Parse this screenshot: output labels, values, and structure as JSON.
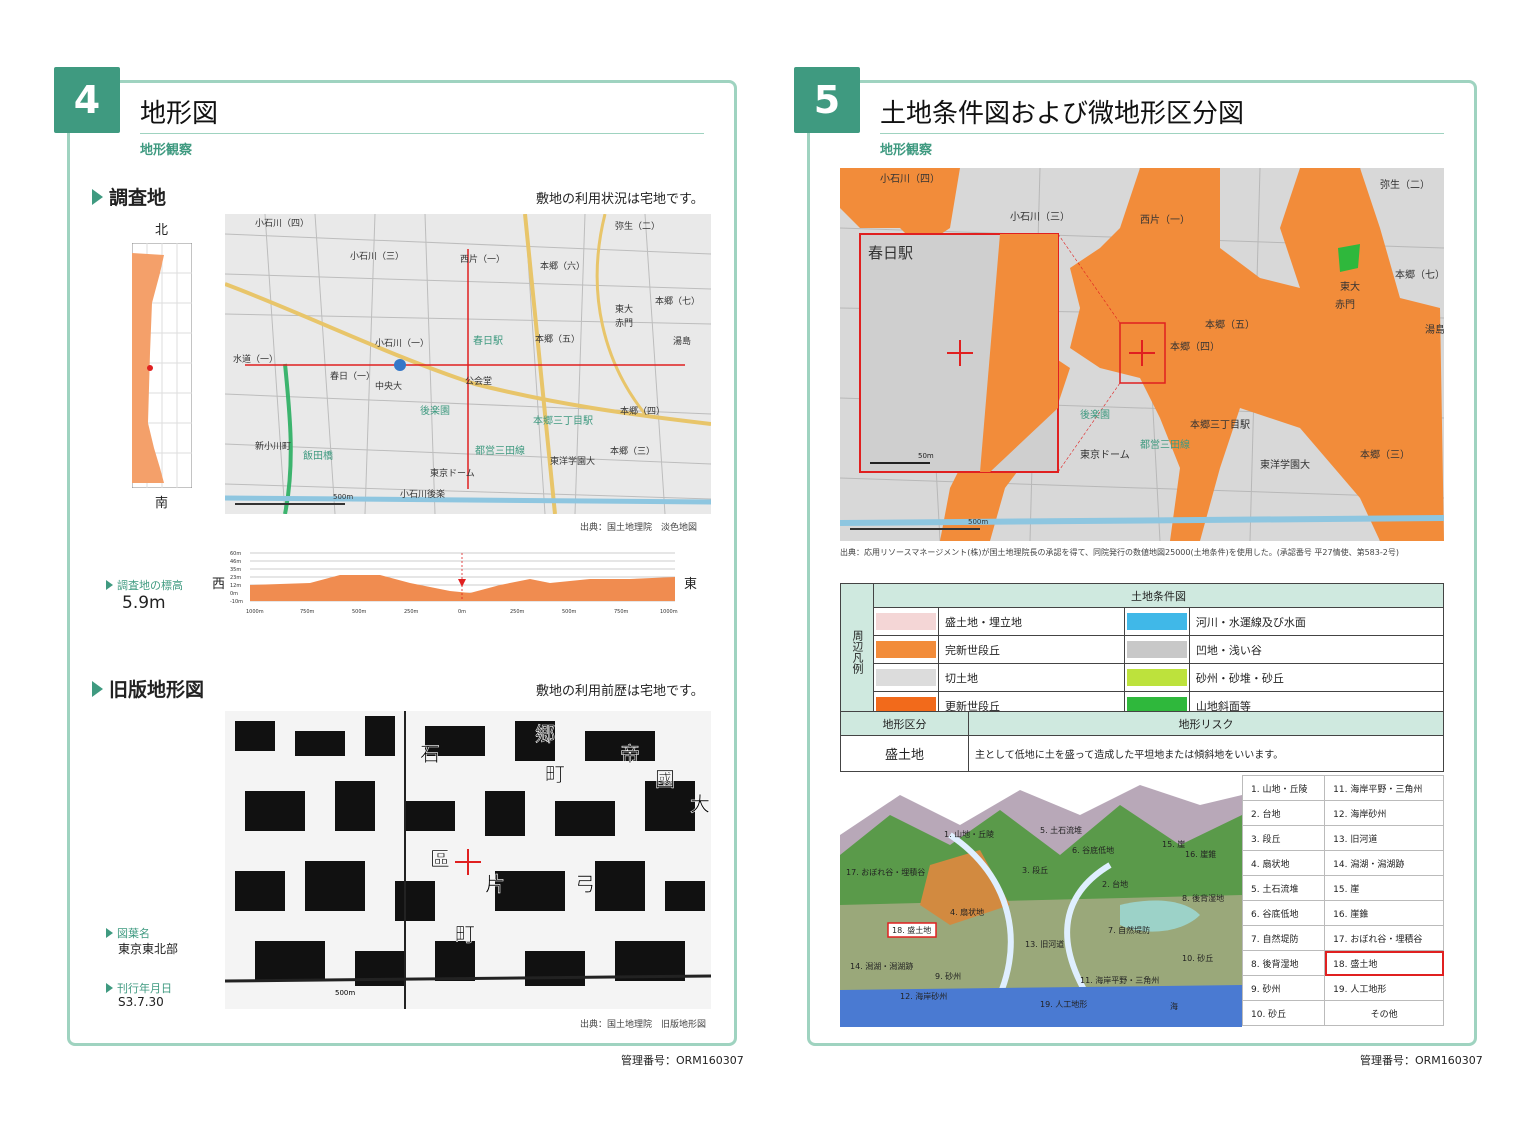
{
  "p4": {
    "num": "4",
    "title": "地形図",
    "subtitle": "地形観察",
    "s1": {
      "head": "調査地",
      "note": "敷地の利用状況は宅地です。",
      "north": "北",
      "south": "南",
      "source": "出典：国土地理院　淡色地図",
      "map_labels": [
        "小石川（四）",
        "小石川（三）",
        "西片（一）",
        "本郷（六）",
        "弥生（二）",
        "本郷（七）",
        "東大",
        "赤門",
        "小石川（一）",
        "春日駅",
        "本郷（五）",
        "湯島",
        "水道（一）",
        "春日（一）",
        "中央大",
        "公会堂",
        "後楽園",
        "本郷三丁目駅",
        "本郷（四）",
        "新小川町",
        "飯田橋",
        "都営三田線",
        "東洋学園大",
        "本郷（三）",
        "東京ドーム",
        "小石川後楽",
        "500m"
      ],
      "elev_label": "調査地の標高",
      "elev_value": "5.9m",
      "west": "西",
      "east": "東",
      "y_ticks": [
        "60m",
        "46m",
        "35m",
        "23m",
        "12m",
        "0m",
        "-10m"
      ],
      "x_ticks": [
        "1000m",
        "750m",
        "500m",
        "250m",
        "0m",
        "250m",
        "500m",
        "750m",
        "1000m"
      ]
    },
    "s2": {
      "head": "旧版地形図",
      "note": "敷地の利用前歴は宅地です。",
      "sheet_label": "図葉名",
      "sheet_value": "東京東北部",
      "date_label": "刊行年月日",
      "date_value": "S3.7.30",
      "source": "出典：国土地理院　旧版地形図",
      "old_labels": [
        "郷",
        "石",
        "帝",
        "國",
        "大",
        "町",
        "區",
        "片",
        "町",
        "弓",
        "500m"
      ]
    },
    "mgmt": "管理番号：ORM160307"
  },
  "p5": {
    "num": "5",
    "title": "土地条件図および微地形区分図",
    "subtitle": "地形観察",
    "map_labels": [
      "小石川（四）",
      "小石川（三）",
      "西片（一）",
      "弥生（二）",
      "春日駅",
      "本郷（七）",
      "東大",
      "赤門",
      "本郷（五）",
      "湯島",
      "本郷（四）",
      "本郷三丁目駅",
      "後楽園",
      "都営三田線",
      "東京ドーム",
      "東洋学園大",
      "本郷（三）",
      "50m",
      "500m"
    ],
    "source": "出典：応用リソースマネージメント(株)が国土地理院長の承認を得て、同院発行の数値地図25000(土地条件)を使用した。(承認番号 平27情使、第583-2号)",
    "legend": {
      "side": "周辺凡例",
      "title": "土地条件図",
      "items": [
        {
          "label": "盛土地・埋立地",
          "color": "#f4d6d6"
        },
        {
          "label": "河川・水運線及び水面",
          "color": "#40b8e8"
        },
        {
          "label": "完新世段丘",
          "color": "#f28c3a"
        },
        {
          "label": "凹地・浅い谷",
          "color": "#c8c8c8"
        },
        {
          "label": "切土地",
          "color": "#dcdcdc"
        },
        {
          "label": "砂州・砂堆・砂丘",
          "color": "#bde23c"
        },
        {
          "label": "更新世段丘",
          "color": "#f26a1b"
        },
        {
          "label": "山地斜面等",
          "color": "#2fb83c"
        }
      ]
    },
    "class": {
      "h1": "地形区分",
      "h2": "地形リスク",
      "term": "盛土地",
      "desc": "主として低地に土を盛って造成した平坦地または傾斜地をいいます。"
    },
    "types": [
      [
        "1. 山地・丘陵",
        "11. 海岸平野・三角州"
      ],
      [
        "2. 台地",
        "12. 海岸砂州"
      ],
      [
        "3. 段丘",
        "13. 旧河道"
      ],
      [
        "4. 扇状地",
        "14. 潟湖・潟湖跡"
      ],
      [
        "5. 土石流堆",
        "15. 崖"
      ],
      [
        "6. 谷底低地",
        "16. 崖錐"
      ],
      [
        "7. 自然堤防",
        "17. おぼれ谷・埋積谷"
      ],
      [
        "8. 後背湿地",
        "18. 盛土地"
      ],
      [
        "9. 砂州",
        "19. 人工地形"
      ],
      [
        "10. 砂丘",
        "その他"
      ]
    ],
    "ill_labels": [
      "1. 山地・丘陵",
      "5. 土石流堆",
      "6. 谷底低地",
      "15. 崖",
      "16. 崖錐",
      "17. おぼれ谷・埋積谷",
      "3. 段丘",
      "2. 台地",
      "8. 後背湿地",
      "4. 扇状地",
      "18. 盛土地",
      "7. 自然堤防",
      "13. 旧河道",
      "10. 砂丘",
      "14. 潟湖・潟湖跡",
      "9. 砂州",
      "11. 海岸平野・三角州",
      "12. 海岸砂州",
      "19. 人工地形",
      "海"
    ],
    "mgmt": "管理番号：ORM160307"
  },
  "colors": {
    "accent": "#3f9a80",
    "border": "#9fd3c0",
    "header_fill": "#cfe9df",
    "highlight": "#e02020",
    "terrace": "#f28c3a"
  }
}
